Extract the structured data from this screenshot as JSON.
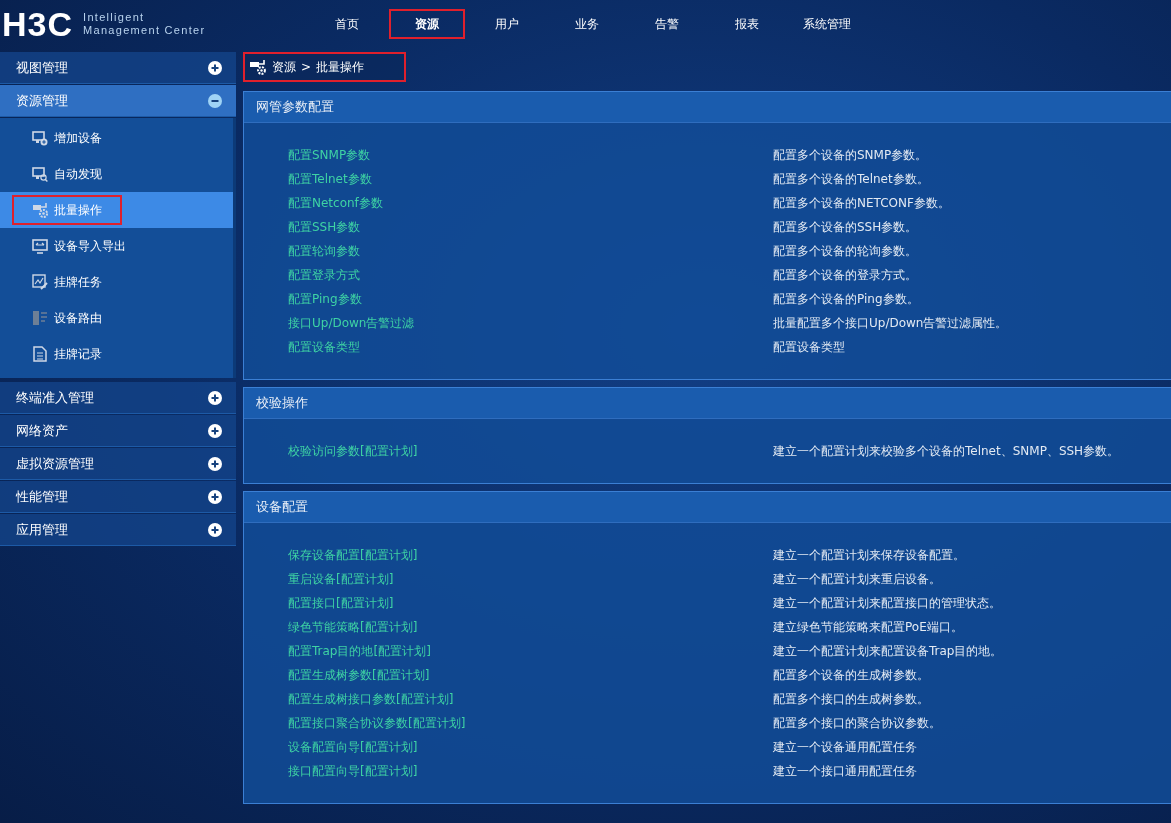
{
  "logo": {
    "mark": "H3C",
    "line1": "Intelligent",
    "line2": "Management Center"
  },
  "nav": [
    {
      "label": "首页",
      "selected": false,
      "annotated": false
    },
    {
      "label": "资源",
      "selected": true,
      "annotated": true
    },
    {
      "label": "用户",
      "selected": false,
      "annotated": false
    },
    {
      "label": "业务",
      "selected": false,
      "annotated": false
    },
    {
      "label": "告警",
      "selected": false,
      "annotated": false
    },
    {
      "label": "报表",
      "selected": false,
      "annotated": false
    },
    {
      "label": "系统管理",
      "selected": false,
      "annotated": false
    }
  ],
  "sidebar": {
    "sections": [
      {
        "label": "视图管理",
        "expanded": false,
        "selected": false
      },
      {
        "label": "资源管理",
        "expanded": true,
        "selected": true,
        "children": [
          {
            "label": "增加设备",
            "selected": false,
            "annotated": false
          },
          {
            "label": "自动发现",
            "selected": false,
            "annotated": false
          },
          {
            "label": "批量操作",
            "selected": true,
            "annotated": true
          },
          {
            "label": "设备导入导出",
            "selected": false,
            "annotated": false
          },
          {
            "label": "挂牌任务",
            "selected": false,
            "annotated": false
          },
          {
            "label": "设备路由",
            "selected": false,
            "annotated": false
          },
          {
            "label": "挂牌记录",
            "selected": false,
            "annotated": false
          }
        ]
      },
      {
        "label": "终端准入管理",
        "expanded": false,
        "selected": false
      },
      {
        "label": "网络资产",
        "expanded": false,
        "selected": false
      },
      {
        "label": "虚拟资源管理",
        "expanded": false,
        "selected": false
      },
      {
        "label": "性能管理",
        "expanded": false,
        "selected": false
      },
      {
        "label": "应用管理",
        "expanded": false,
        "selected": false
      }
    ]
  },
  "breadcrumb": {
    "parts": [
      "资源",
      "批量操作"
    ],
    "separator": ">",
    "annotated": true
  },
  "panels": [
    {
      "title": "网管参数配置",
      "rows": [
        {
          "link": "配置SNMP参数",
          "description": "配置多个设备的SNMP参数。"
        },
        {
          "link": "配置Telnet参数",
          "description": "配置多个设备的Telnet参数。"
        },
        {
          "link": "配置Netconf参数",
          "description": "配置多个设备的NETCONF参数。"
        },
        {
          "link": "配置SSH参数",
          "description": "配置多个设备的SSH参数。"
        },
        {
          "link": "配置轮询参数",
          "description": "配置多个设备的轮询参数。"
        },
        {
          "link": "配置登录方式",
          "description": "配置多个设备的登录方式。"
        },
        {
          "link": "配置Ping参数",
          "description": "配置多个设备的Ping参数。"
        },
        {
          "link": "接口Up/Down告警过滤",
          "description": "批量配置多个接口Up/Down告警过滤属性。"
        },
        {
          "link": "配置设备类型",
          "description": "配置设备类型"
        }
      ]
    },
    {
      "title": "校验操作",
      "rows": [
        {
          "link": "校验访问参数[配置计划]",
          "description": "建立一个配置计划来校验多个设备的Telnet、SNMP、SSH参数。"
        }
      ]
    },
    {
      "title": "设备配置",
      "rows": [
        {
          "link": "保存设备配置[配置计划]",
          "description": "建立一个配置计划来保存设备配置。"
        },
        {
          "link": "重启设备[配置计划]",
          "description": "建立一个配置计划来重启设备。"
        },
        {
          "link": "配置接口[配置计划]",
          "description": "建立一个配置计划来配置接口的管理状态。"
        },
        {
          "link": "绿色节能策略[配置计划]",
          "description": "建立绿色节能策略来配置PoE端口。"
        },
        {
          "link": "配置Trap目的地[配置计划]",
          "description": "建立一个配置计划来配置设备Trap目的地。"
        },
        {
          "link": "配置生成树参数[配置计划]",
          "description": "配置多个设备的生成树参数。"
        },
        {
          "link": "配置生成树接口参数[配置计划]",
          "description": "配置多个接口的生成树参数。"
        },
        {
          "link": "配置接口聚合协议参数[配置计划]",
          "description": "配置多个接口的聚合协议参数。"
        },
        {
          "link": "设备配置向导[配置计划]",
          "description": "建立一个设备通用配置任务"
        },
        {
          "link": "接口配置向导[配置计划]",
          "description": "建立一个接口通用配置任务"
        }
      ]
    }
  ]
}
